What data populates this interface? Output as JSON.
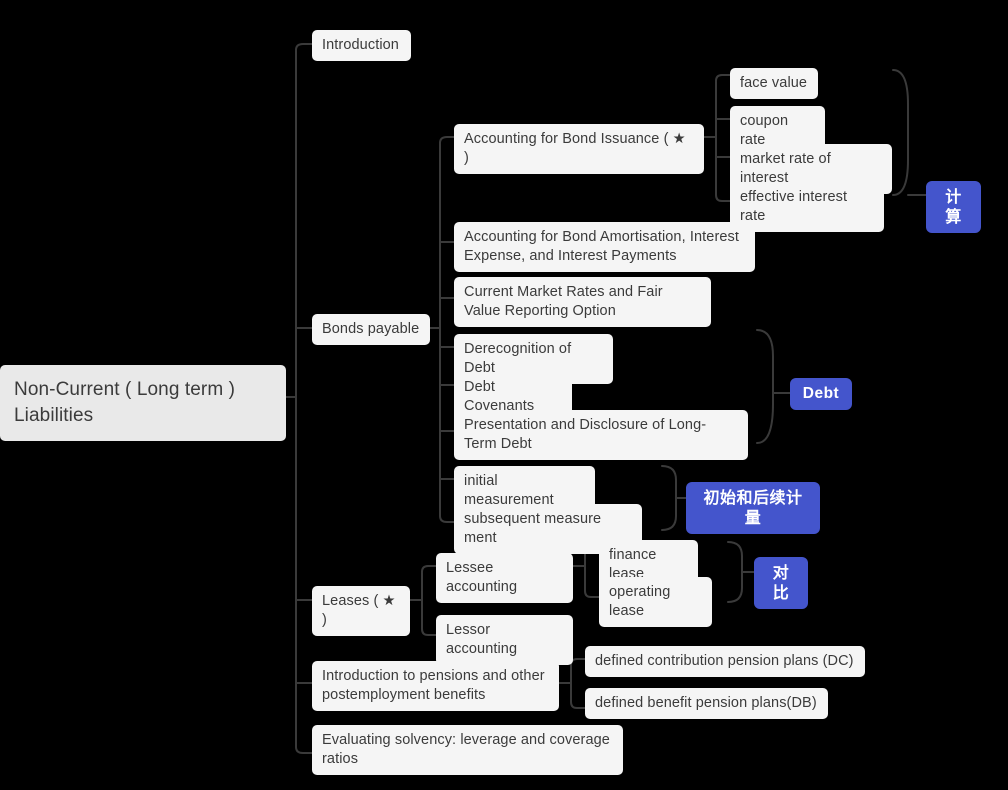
{
  "diagram": {
    "title": "Non-Current ( Long term ) Liabilities mind map",
    "colors": {
      "background": "#000000",
      "node_fill": "#f5f5f5",
      "root_fill": "#e9e9e9",
      "node_text": "#3b3b3b",
      "connector": "#3a3a3a",
      "badge_fill": "#4455cc",
      "badge_text": "#ffffff"
    }
  },
  "root": {
    "label": "Non-Current ( Long term ) Liabilities"
  },
  "branches": {
    "introduction": {
      "label": "Introduction"
    },
    "bonds_payable": {
      "label": "Bonds payable"
    },
    "leases": {
      "label": "Leases ( ★ )"
    },
    "pensions": {
      "label": "Introduction to pensions and other postemployment benefits"
    },
    "solvency": {
      "label": "Evaluating solvency: leverage and coverage ratios"
    }
  },
  "bonds_children": {
    "issuance": {
      "label": "Accounting for Bond Issuance ( ★ )"
    },
    "amortisation": {
      "label": "Accounting for Bond Amortisation, Interest Expense, and Interest Payments"
    },
    "fair_value": {
      "label": "Current Market Rates and Fair Value Reporting Option"
    },
    "derecognition": {
      "label": "Derecognition of Debt"
    },
    "covenants": {
      "label": "Debt Covenants"
    },
    "presentation": {
      "label": "Presentation and Disclosure of Long-Term Debt"
    },
    "initial_measurement": {
      "label": "initial measurement"
    },
    "subsequent_measurement": {
      "label": "subsequent measure ment"
    }
  },
  "issuance_children": {
    "face_value": {
      "label": "face value"
    },
    "coupon_rate": {
      "label": "coupon rate"
    },
    "market_rate": {
      "label": "market rate of interest"
    },
    "effective_rate": {
      "label": "effective interest rate"
    }
  },
  "leases_children": {
    "lessee": {
      "label": "Lessee accounting"
    },
    "lessor": {
      "label": "Lessor accounting"
    }
  },
  "lessee_children": {
    "finance_lease": {
      "label": "finance lease"
    },
    "operating_lease": {
      "label": "operating lease"
    }
  },
  "pension_children": {
    "dc": {
      "label": "defined contribution pension plans (DC)"
    },
    "db": {
      "label": "defined benefit pension plans(DB)"
    }
  },
  "badges": {
    "calculation": {
      "label": "计算"
    },
    "debt": {
      "label": "Debt"
    },
    "measurement": {
      "label": "初始和后续计量"
    },
    "comparison": {
      "label": "对比"
    }
  }
}
